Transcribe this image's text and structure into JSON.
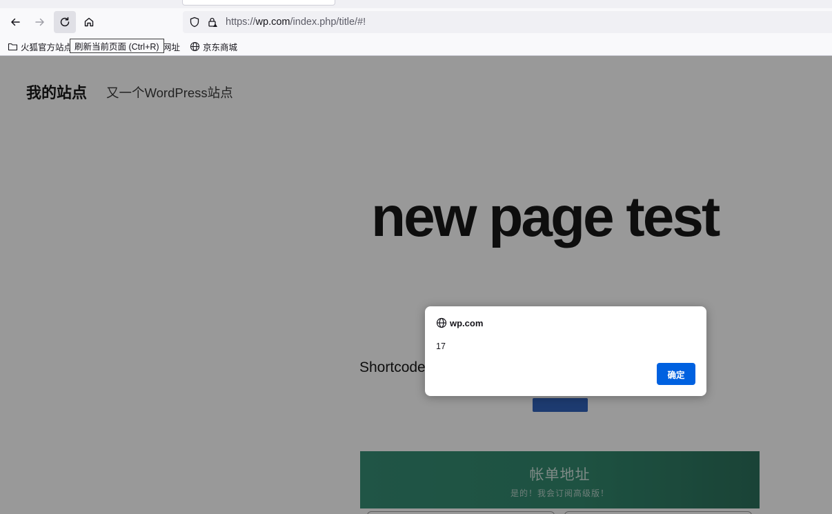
{
  "browser": {
    "address_bar": {
      "prefix": "https://",
      "host": "wp.com",
      "path": "/index.php/title/#!"
    },
    "tooltip": "刷新当前页面 (Ctrl+R)",
    "bookmarks": [
      {
        "label": "火狐官方站点",
        "icon": "folder-icon"
      },
      {
        "label": "网址",
        "icon": "folder-icon"
      },
      {
        "label": "京东商城",
        "icon": "globe-icon"
      }
    ]
  },
  "site": {
    "title": "我的站点",
    "tagline": "又一个WordPress站点"
  },
  "main": {
    "headline": "new page test",
    "shortcode_text": "Shortcode",
    "promo": {
      "title": "帐单地址",
      "subtitle": "是的！我会订阅高级版！"
    }
  },
  "dialog": {
    "origin": "wp.com",
    "message": "17",
    "ok_label": "确定"
  },
  "colors": {
    "ok_button": "#0061e0",
    "promo_green": "#2b8569",
    "blue_button": "#2a5db8"
  }
}
